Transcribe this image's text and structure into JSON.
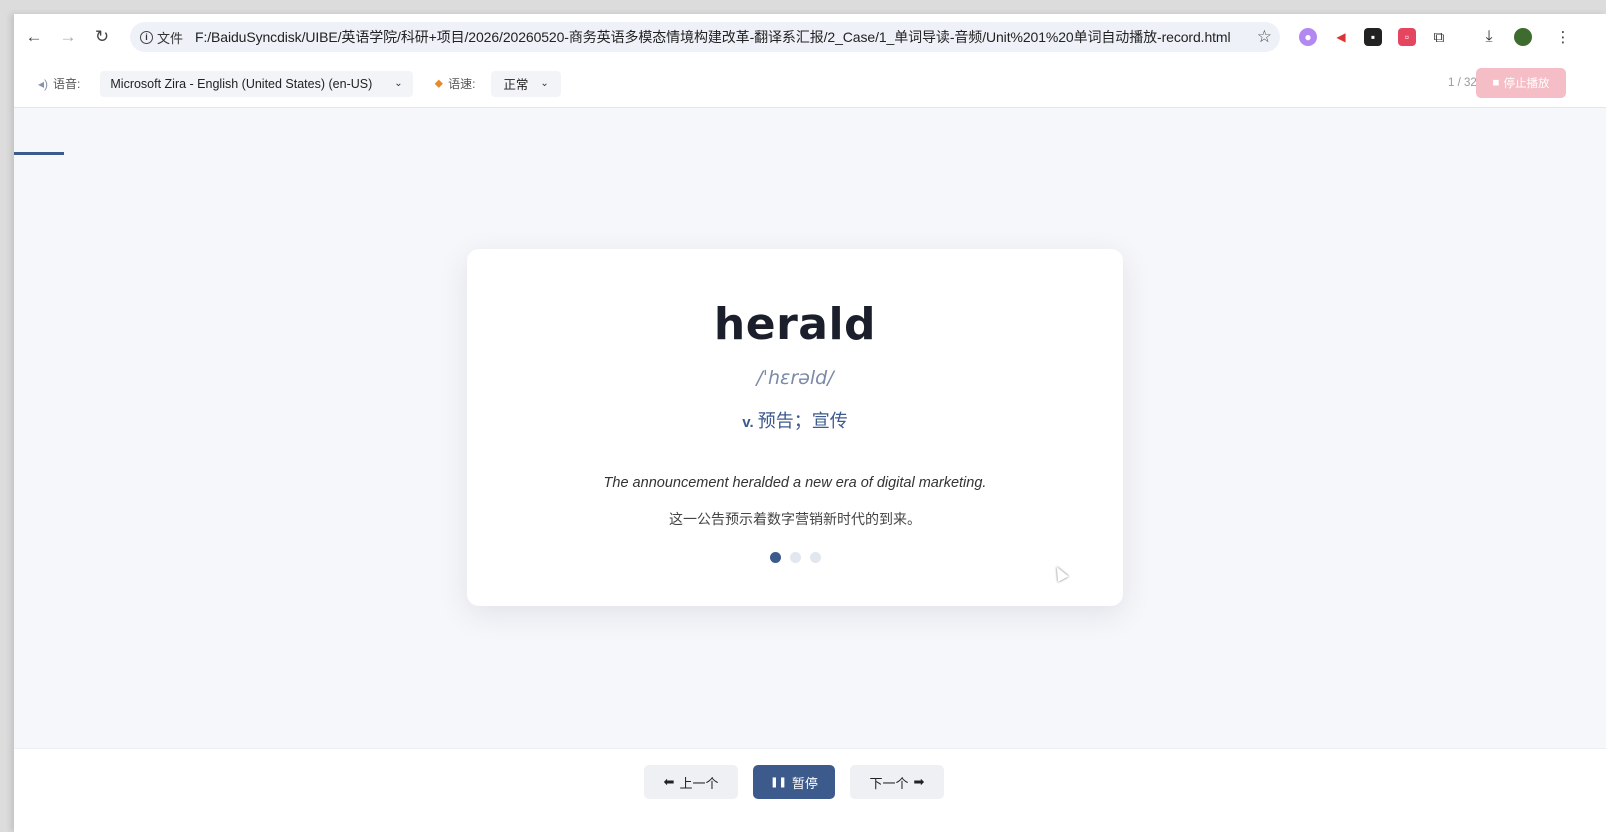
{
  "browser": {
    "site_info_label": "文件",
    "url": "F:/BaiduSyncdisk/UIBE/英语学院/科研+项目/2026/20260520-商务英语多模态情境构建改革-翻译系汇报/2_Case/1_单词导读-音频/Unit%201%20单词自动播放-record.html",
    "icons": [
      "back-arrow-icon",
      "forward-arrow-icon",
      "reload-icon",
      "star-icon",
      "download-icon",
      "menu-icon"
    ]
  },
  "toolbar": {
    "voice_label": "语音:",
    "voice_value": "Microsoft Zira - English (United States) (en-US)",
    "rate_label": "语速:",
    "rate_value": "正常",
    "progress_text": "1 / 32.",
    "stop_label": "停止播放",
    "progress_fraction": 0.03125
  },
  "card": {
    "word": "herald",
    "phonetic": "/ˈhɛrəld/",
    "pos": "v.",
    "meaning": "预告；宣传",
    "example_en": "The announcement heralded a new era of digital marketing.",
    "example_zh": "这一公告预示着数字营销新时代的到来。",
    "dots": [
      true,
      false,
      false
    ]
  },
  "controls": {
    "prev_label": "上一个",
    "pause_label": "暂停",
    "next_label": "下一个"
  },
  "colors": {
    "accent": "#3d5a8c",
    "stop_button": "#f5bdc5",
    "background": "#f6f7fa"
  }
}
